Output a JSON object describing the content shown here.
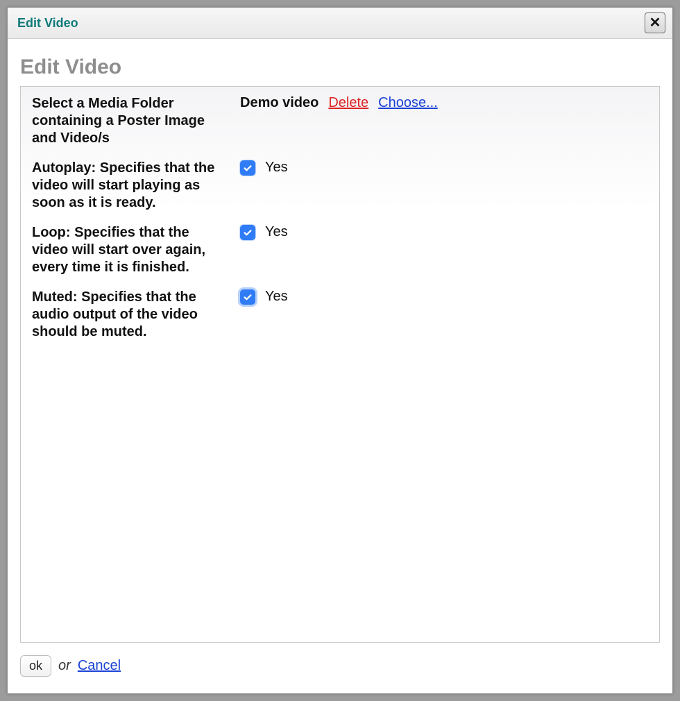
{
  "dialog": {
    "title": "Edit Video",
    "close_symbol": "✕"
  },
  "page": {
    "heading": "Edit Video"
  },
  "form": {
    "folder": {
      "label": "Select a Media Folder containing a Poster Image and Video/s",
      "value": "Demo video",
      "delete_label": "Delete",
      "choose_label": "Choose..."
    },
    "autoplay": {
      "label": "Autoplay: Specifies that the video will start playing as soon as it is ready.",
      "checked": true,
      "text": "Yes"
    },
    "loop": {
      "label": "Loop: Specifies that the video will start over again, every time it is finished.",
      "checked": true,
      "text": "Yes"
    },
    "muted": {
      "label": "Muted: Specifies that the audio output of the video should be muted.",
      "checked": true,
      "text": "Yes",
      "focused": true
    }
  },
  "actions": {
    "ok_label": "ok",
    "or_text": "or",
    "cancel_label": "Cancel"
  }
}
